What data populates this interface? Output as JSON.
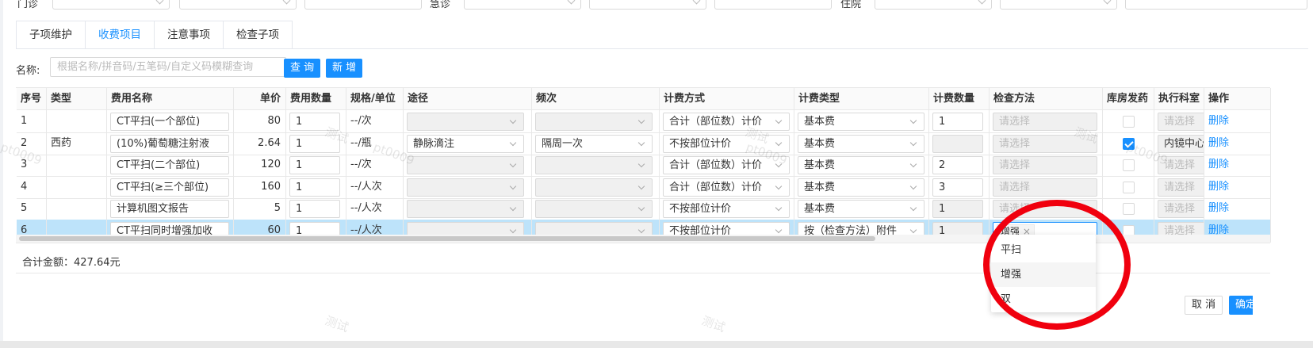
{
  "filters": {
    "label1": "门诊",
    "label2": "急诊",
    "label3": "住院"
  },
  "tabs": [
    "子项维护",
    "收费项目",
    "注意事项",
    "检查子项"
  ],
  "active_tab": "收费项目",
  "search": {
    "label": "名称:",
    "placeholder": "根据名称/拼音码/五笔码/自定义码模糊查询",
    "query_btn": "查 询",
    "add_btn": "新 增"
  },
  "table": {
    "headers": [
      "序号",
      "类型",
      "费用名称",
      "单价",
      "费用数量",
      "规格/单位",
      "途径",
      "频次",
      "计费方式",
      "计费类型",
      "计费数量",
      "检查方法",
      "库房发药",
      "执行科室",
      "操作"
    ],
    "rows": [
      {
        "no": "1",
        "type": "",
        "name": "CT平扫(一个部位)",
        "price": "80",
        "qty": "1",
        "unit": "--/次",
        "route": "",
        "freq": "",
        "method": "合计（部位数）计价",
        "ftype": "基本费",
        "fqty": "1",
        "check": "请选择",
        "pharm": false,
        "dept": "请选择",
        "op": "删除"
      },
      {
        "no": "2",
        "type": "西药",
        "name": "(10%)葡萄糖注射液",
        "price": "2.64",
        "qty": "1",
        "unit": "--/瓶",
        "route": "静脉滴注",
        "freq": "隔周一次",
        "method": "不按部位计价",
        "ftype": "基本费",
        "fqty": "",
        "check": "请选择",
        "pharm": true,
        "dept": "内镜中心",
        "op": "删除"
      },
      {
        "no": "3",
        "type": "",
        "name": "CT平扫(二个部位)",
        "price": "120",
        "qty": "1",
        "unit": "--/次",
        "route": "",
        "freq": "",
        "method": "合计（部位数）计价",
        "ftype": "基本费",
        "fqty": "2",
        "check": "请选择",
        "pharm": false,
        "dept": "请选择",
        "op": "删除"
      },
      {
        "no": "4",
        "type": "",
        "name": "CT平扫(≥三个部位)",
        "price": "160",
        "qty": "1",
        "unit": "--/人次",
        "route": "",
        "freq": "",
        "method": "合计（部位数）计价",
        "ftype": "基本费",
        "fqty": "3",
        "check": "请选择",
        "pharm": false,
        "dept": "请选择",
        "op": "删除"
      },
      {
        "no": "5",
        "type": "",
        "name": "计算机图文报告",
        "price": "5",
        "qty": "1",
        "unit": "--/人次",
        "route": "",
        "freq": "",
        "method": "不按部位计价",
        "ftype": "基本费",
        "fqty": "1",
        "check": "请选择",
        "pharm": false,
        "dept": "请选择",
        "op": "删除"
      },
      {
        "no": "6",
        "type": "",
        "name": "CT平扫同时增强加收",
        "price": "60",
        "qty": "1",
        "unit": "--/人次",
        "route": "",
        "freq": "",
        "method": "不按部位计价",
        "ftype": "按（检查方法）附件",
        "fqty": "1",
        "check": "增强",
        "pharm": false,
        "dept": "请选择",
        "op": "删除"
      }
    ]
  },
  "total": "合计金额：427.64元",
  "dropdown": {
    "options": [
      "平扫",
      "增强",
      "双"
    ],
    "highlighted": "增强"
  },
  "footer": {
    "cancel": "取 消",
    "confirm": "确定"
  },
  "watermark": {
    "text1": "测试",
    "text2": "pt0009"
  },
  "colors": {
    "primary": "#1890ff",
    "selected_row": "#bde3fa",
    "annotation": "#f0000e"
  }
}
